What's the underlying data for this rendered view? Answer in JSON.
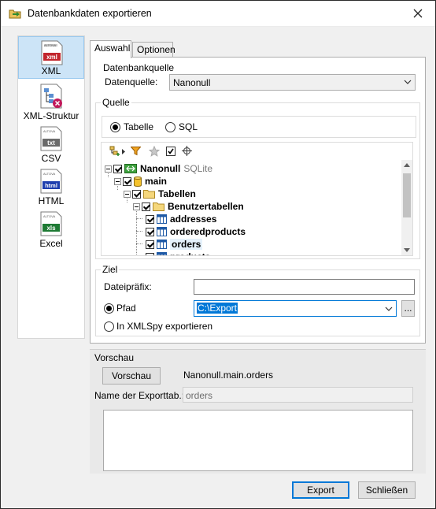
{
  "window": {
    "title": "Datenbankdaten exportieren",
    "close_label": "✕"
  },
  "formats": [
    {
      "label": "XML",
      "badge": "xml",
      "color": "#c2262d",
      "selected": true
    },
    {
      "label": "XML-Struktur",
      "badge": "",
      "color": "#1f5aa6",
      "selected": false
    },
    {
      "label": "CSV",
      "badge": "txt",
      "color": "#6b6b6b",
      "selected": false
    },
    {
      "label": "HTML",
      "badge": "html",
      "color": "#1f3fae",
      "selected": false
    },
    {
      "label": "Excel",
      "badge": "xls",
      "color": "#1e7a34",
      "selected": false
    }
  ],
  "icon_brand": "ALTOVA",
  "tabs": [
    {
      "label": "Auswahl",
      "active": true
    },
    {
      "label": "Optionen",
      "active": false
    }
  ],
  "db_source": {
    "group_title": "Datenbankquelle",
    "label": "Datenquelle:",
    "value": "Nanonull"
  },
  "source": {
    "group_title": "Quelle",
    "radio_table": "Tabelle",
    "radio_sql": "SQL",
    "selected": "Tabelle"
  },
  "tree": {
    "root": {
      "label": "Nanonull",
      "suffix": "SQLite"
    },
    "schema": "main",
    "tables_folder": "Tabellen",
    "user_tables_folder": "Benutzertabellen",
    "tables": [
      "addresses",
      "orderedproducts",
      "orders",
      "products"
    ],
    "selected_table": "orders"
  },
  "target": {
    "group_title": "Ziel",
    "prefix_label": "Dateipräfix:",
    "prefix_value": "",
    "path_radio": "Pfad",
    "path_value": "C:\\Export",
    "browse_label": "...",
    "xmlspy_radio": "In XMLSpy exportieren",
    "selected": "Pfad"
  },
  "preview": {
    "group_title": "Vorschau",
    "button": "Vorschau",
    "current": "Nanonull.main.orders",
    "export_table_label": "Name der Exporttab.:",
    "export_table_value": "orders",
    "output": ""
  },
  "footer": {
    "export": "Export",
    "close": "Schließen"
  }
}
